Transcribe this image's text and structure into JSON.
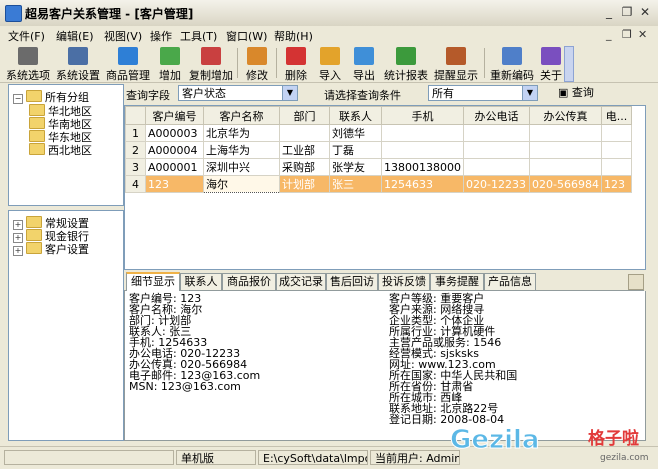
{
  "window": {
    "title": "超易客户关系管理 - [客户管理]"
  },
  "menu": [
    {
      "label": "文件(F)"
    },
    {
      "label": "编辑(E)"
    },
    {
      "label": "视图(V)"
    },
    {
      "label": "操作"
    },
    {
      "label": "工具(T)"
    },
    {
      "label": "窗口(W)"
    },
    {
      "label": "帮助(H)"
    }
  ],
  "toolbar": [
    {
      "label": "系统选项",
      "icon": "tools-icon",
      "color": "#6b6b6b"
    },
    {
      "label": "系统设置",
      "icon": "settings-icon",
      "color": "#4b6fa5"
    },
    {
      "label": "商品管理",
      "icon": "database-icon",
      "color": "#2e7fd6"
    },
    {
      "label": "增加",
      "icon": "add-user-icon",
      "color": "#4aa84a"
    },
    {
      "label": "复制增加",
      "icon": "copy-add-icon",
      "color": "#c94040"
    },
    {
      "label": "修改",
      "icon": "pencil-icon",
      "color": "#d9882b"
    },
    {
      "label": "删除",
      "icon": "delete-icon",
      "color": "#d43333"
    },
    {
      "label": "导入",
      "icon": "import-icon",
      "color": "#e3a32b"
    },
    {
      "label": "导出",
      "icon": "export-icon",
      "color": "#3f8fd8"
    },
    {
      "label": "统计报表",
      "icon": "chart-icon",
      "color": "#3c9a3c"
    },
    {
      "label": "提醒显示",
      "icon": "reminder-icon",
      "color": "#b55a2a"
    },
    {
      "label": "重新编码",
      "icon": "recode-icon",
      "color": "#4f7fc9"
    },
    {
      "label": "关于",
      "icon": "help-icon",
      "color": "#7a4fbf"
    }
  ],
  "tree_groups": {
    "root": "所有分组",
    "children": [
      "华北地区",
      "华南地区",
      "华东地区",
      "西北地区"
    ]
  },
  "tree_settings": [
    "常规设置",
    "现金银行",
    "客户设置"
  ],
  "query": {
    "field_label": "查询字段",
    "field_value": "客户状态",
    "cond_label": "请选择查询条件",
    "cond_value": "所有",
    "button": "查询"
  },
  "grid": {
    "columns": [
      "客户编号",
      "客户名称",
      "部门",
      "联系人",
      "手机",
      "办公电话",
      "办公传真",
      "电..."
    ],
    "rows": [
      {
        "n": "1",
        "cells": [
          "A000003",
          "北京华为",
          "",
          "刘德华",
          "",
          "",
          "",
          ""
        ]
      },
      {
        "n": "2",
        "cells": [
          "A000004",
          "上海华为",
          "工业部",
          "丁磊",
          "",
          "",
          "",
          ""
        ]
      },
      {
        "n": "3",
        "cells": [
          "A000001",
          "深圳中兴",
          "采购部",
          "张学友",
          "13800138000",
          "",
          "",
          ""
        ]
      },
      {
        "n": "4",
        "cells": [
          "123",
          "海尔",
          "计划部",
          "张三",
          "1254633",
          "020-12233",
          "020-566984",
          "123"
        ]
      }
    ]
  },
  "tabs": [
    "细节显示",
    "联系人",
    "商品报价",
    "成交记录",
    "售后回访",
    "投诉反馈",
    "事务提醒",
    "产品信息"
  ],
  "detail": {
    "left": [
      "客户编号: 123",
      "客户名称: 海尔",
      "部门: 计划部",
      "联系人: 张三",
      "手机: 1254633",
      "办公电话: 020-12233",
      "办公传真: 020-566984",
      "电子邮件: 123@163.com",
      "MSN: 123@163.com"
    ],
    "right": [
      "客户等级: 重要客户",
      "客户来源: 网络搜寻",
      "企业类型: 个体企业",
      "所属行业: 计算机硬件",
      "主营产品或服务: 1546",
      "经营模式: sjsksks",
      "网址: www.123.com",
      "所在国家: 中华人民共和国",
      "所在省份: 甘肃省",
      "所在城市: 西峰",
      "联系地址: 北京路22号",
      "登记日期: 2008-08-04"
    ]
  },
  "status": {
    "mode": "单机版",
    "path": "E:\\cySoft\\data\\lmpcyjxc.sys",
    "user": "当前用户: Admin"
  },
  "watermark": {
    "brand": "Gezila",
    "cn": "格子啦",
    "url": "gezila.com"
  }
}
